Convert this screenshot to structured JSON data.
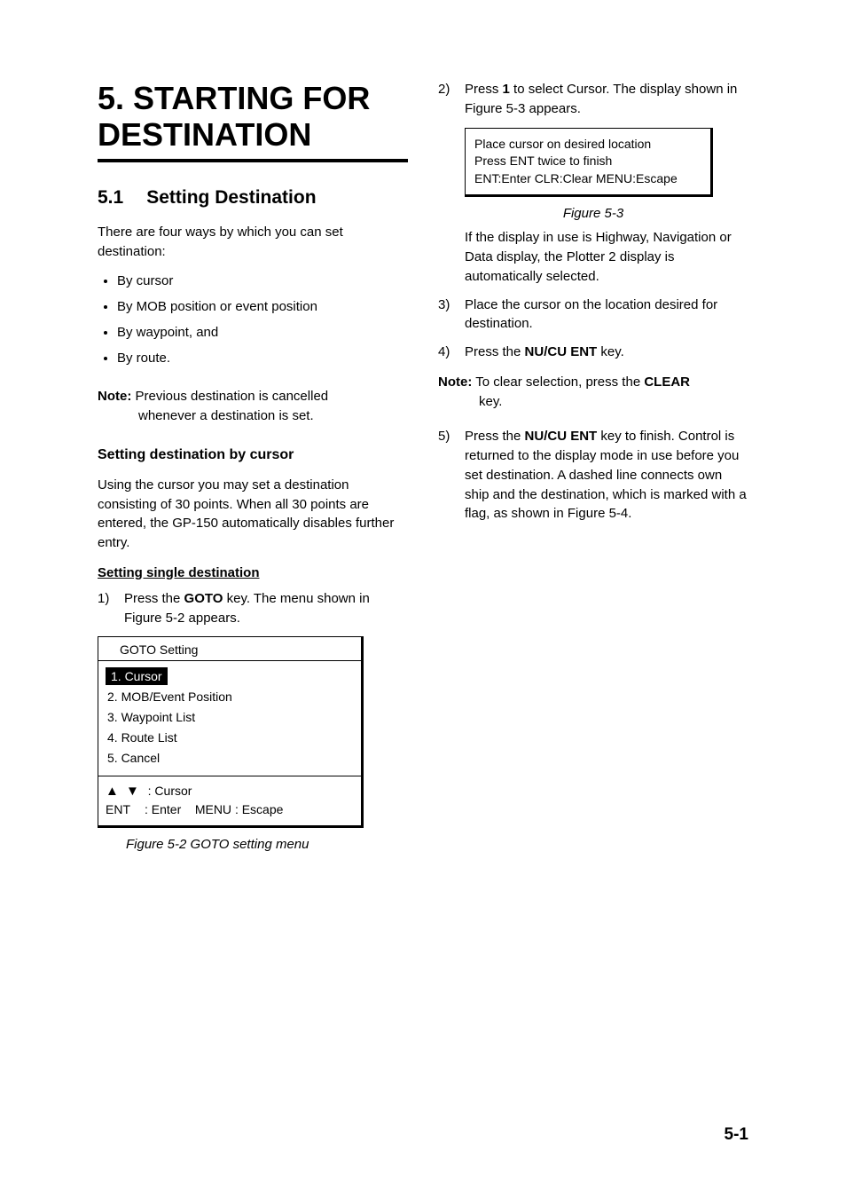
{
  "chapter_title": "5. STARTING FOR DESTINATION",
  "section": {
    "num": "5.1",
    "title": "Setting Destination"
  },
  "intro": "There are four ways by which you can set destination:",
  "bullets": [
    "By cursor",
    "By MOB position or event position",
    "By waypoint, and",
    "By route."
  ],
  "note1": {
    "label": "Note:",
    "line1": "Previous destination is cancelled",
    "line2": "whenever a destination is set."
  },
  "sub_cursor": "Setting destination by cursor",
  "cursor_para": "Using the cursor you may set a destination consisting of 30 points. When all 30 points are entered, the GP-150 automatically disables further entry.",
  "subsub_single": "Setting single destination",
  "step1": {
    "num": "1)",
    "pre": "Press the ",
    "key": "GOTO",
    "post": " key. The menu shown in Figure 5-2 appears."
  },
  "panel_goto": {
    "title": "GOTO Setting",
    "opts": [
      "1. Cursor",
      "2. MOB/Event Position",
      "3. Waypoint List",
      "4. Route List",
      "5. Cancel"
    ],
    "footer_cursor_label": ": Cursor",
    "footer_enter_key": "ENT",
    "footer_enter_lbl": ": Enter",
    "footer_menu_key": "MENU",
    "footer_menu_lbl": ": Escape"
  },
  "caption_52": "Figure 5-2 GOTO setting menu",
  "step2": {
    "num": "2)",
    "pre": "Press ",
    "key": "1",
    "post": " to select Cursor. The display shown in Figure 5-3 appears."
  },
  "panel_cursor": {
    "l1": "Place cursor on desired location",
    "l2": "Press ENT twice to finish",
    "l3": "ENT:Enter CLR:Clear MENU:Escape"
  },
  "caption_53": "Figure 5-3",
  "after53": "If the display in use is Highway, Navigation or Data display, the Plotter 2 display is automatically selected.",
  "step3": {
    "num": "3)",
    "text": "Place the cursor on the location desired for destination."
  },
  "step4": {
    "num": "4)",
    "pre": "Press the ",
    "key": "NU/CU ENT",
    "post": " key."
  },
  "note2": {
    "label": "Note:",
    "pre": "To clear selection, press the ",
    "key": "CLEAR",
    "post": "key."
  },
  "step5": {
    "num": "5)",
    "pre": "Press the ",
    "key": "NU/CU ENT",
    "post": " key to finish. Control is returned to the display mode in use before you set destination. A dashed line connects own ship and the destination, which is marked with a flag, as shown in Figure 5-4."
  },
  "pagenum": "5-1"
}
